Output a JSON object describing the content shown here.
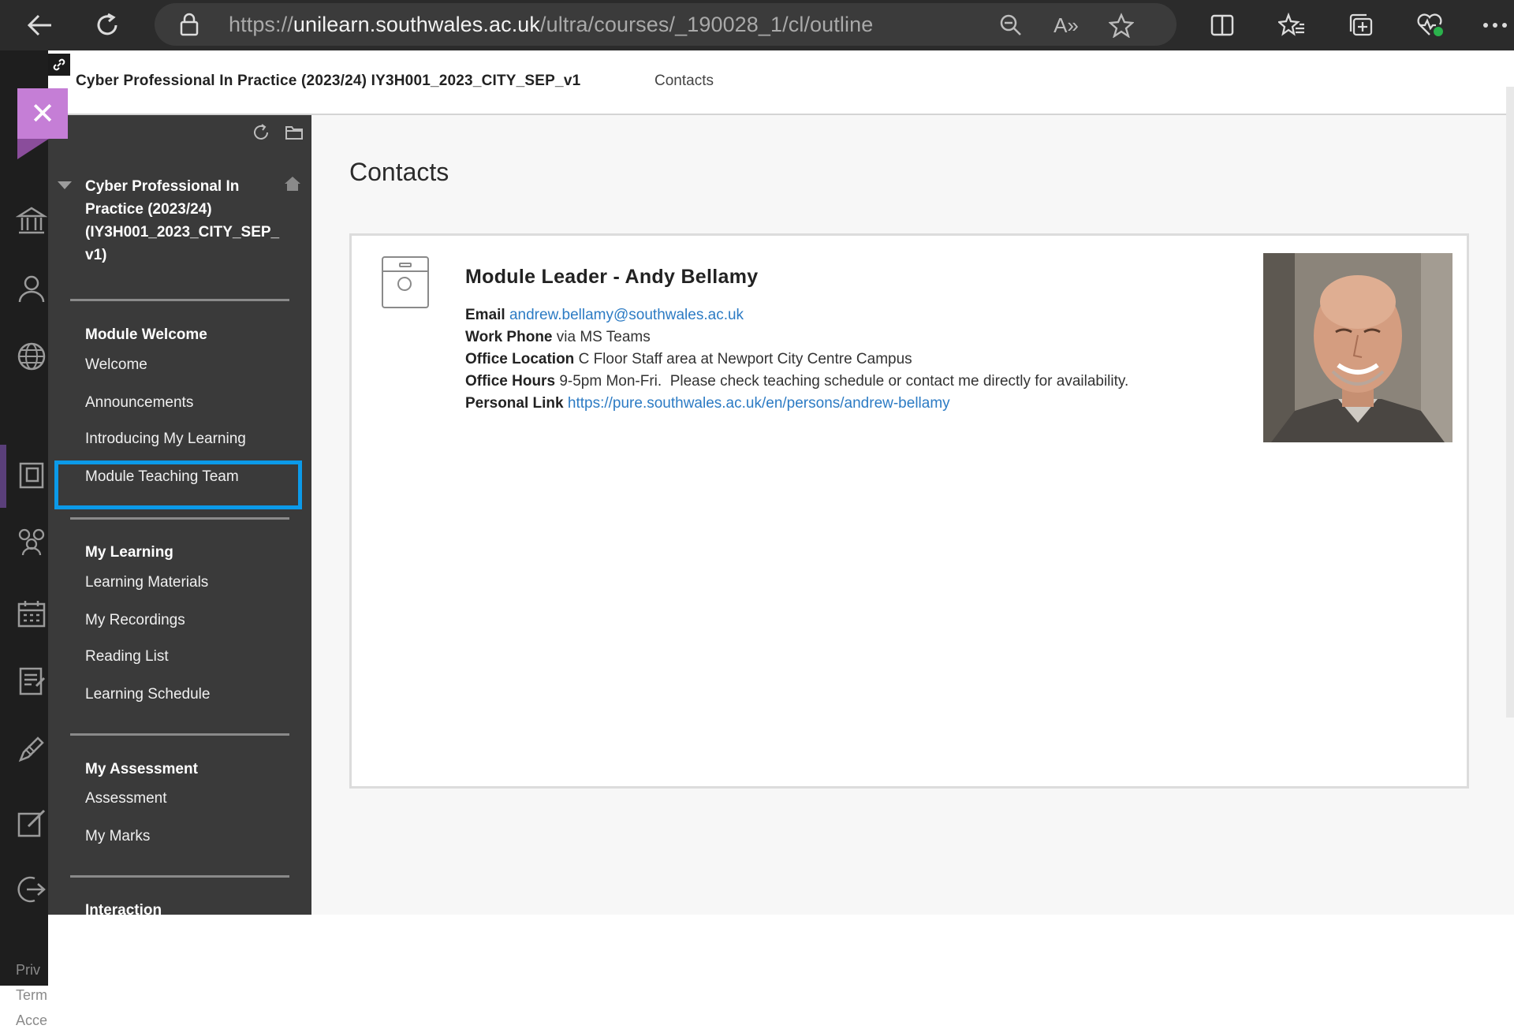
{
  "browser": {
    "url_prefix": "https://",
    "url_host": "unilearn.southwales.ac.uk",
    "url_path": "/ultra/courses/_190028_1/cl/outline",
    "read_aloud_label": "A»"
  },
  "close_glyph": "✕",
  "header": {
    "course_crumb": "Cyber Professional In Practice (2023/24) IY3H001_2023_CITY_SEP_v1",
    "page_crumb": "Contacts"
  },
  "menu": {
    "course_title": "Cyber Professional In Practice (2023/24) (IY3H001_2023_CITY_SEP_ v1)",
    "sections": [
      {
        "heading": "Module Welcome",
        "items": [
          "Welcome",
          "Announcements",
          "Introducing My Learning",
          "Module Teaching Team"
        ]
      },
      {
        "heading": "My Learning",
        "items": [
          "Learning Materials",
          "My Recordings",
          "Reading List",
          "Learning Schedule"
        ]
      },
      {
        "heading": "My Assessment",
        "items": [
          "Assessment",
          "My Marks"
        ]
      },
      {
        "heading": "Interaction",
        "items": []
      }
    ]
  },
  "rail_footer": [
    "Priv",
    "Term",
    "Acce"
  ],
  "content": {
    "title": "Contacts",
    "card": {
      "name": "Module Leader - Andy Bellamy",
      "email_label": "Email",
      "email_value": "andrew.bellamy@southwales.ac.uk",
      "phone_label": "Work Phone",
      "phone_value": "via MS Teams",
      "location_label": "Office Location",
      "location_value": "C Floor Staff area at Newport City Centre Campus",
      "hours_label": "Office Hours",
      "hours_value": "9-5pm Mon-Fri.  Please check teaching schedule or contact me directly for availability.",
      "link_label": "Personal Link",
      "link_value": "https://pure.southwales.ac.uk/en/persons/andrew-bellamy"
    }
  },
  "colors": {
    "accent_purple": "#c57ed6",
    "highlight_blue": "#0b9ae9",
    "link_blue": "#2c7bc4"
  }
}
